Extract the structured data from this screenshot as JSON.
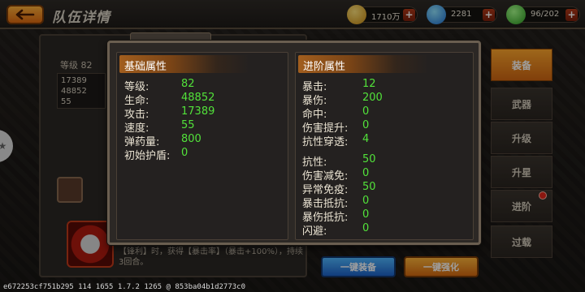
{
  "header": {
    "title": "队伍详情",
    "resources": [
      {
        "icon": "gold-coin-icon",
        "value": "1710万"
      },
      {
        "icon": "blue-gem-icon",
        "value": "2281"
      },
      {
        "icon": "green-stamina-icon",
        "value": "96/202"
      }
    ]
  },
  "background": {
    "rank_label": "等级 82",
    "mini_stats": [
      "17389",
      "48852",
      "55"
    ],
    "description": "【锋利】时，获得【暴击率】（暴击+100%），持续3回合。"
  },
  "side_tabs": [
    {
      "label": "装备",
      "active": true
    },
    {
      "label": "武器",
      "active": false
    },
    {
      "label": "升级",
      "active": false
    },
    {
      "label": "升星",
      "active": false
    },
    {
      "label": "进阶",
      "active": false
    },
    {
      "label": "过载",
      "active": false
    }
  ],
  "buttons": {
    "equip_all": "一键装备",
    "upgrade_all": "一键强化"
  },
  "modal": {
    "basic": {
      "title": "基础属性",
      "stats": [
        {
          "label": "等级:",
          "value": "82"
        },
        {
          "label": "生命:",
          "value": "48852"
        },
        {
          "label": "攻击:",
          "value": "17389"
        },
        {
          "label": "速度:",
          "value": "55"
        },
        {
          "label": "弹药量:",
          "value": "800"
        },
        {
          "label": "初始护盾:",
          "value": "0"
        }
      ]
    },
    "advanced": {
      "title": "进阶属性",
      "stats": [
        {
          "label": "暴击:",
          "value": "12"
        },
        {
          "label": "暴伤:",
          "value": "200"
        },
        {
          "label": "命中:",
          "value": "0"
        },
        {
          "label": "伤害提升:",
          "value": "0"
        },
        {
          "label": "抗性穿透:",
          "value": "4"
        },
        {
          "label": "抗性:",
          "value": "50"
        },
        {
          "label": "伤害减免:",
          "value": "0"
        },
        {
          "label": "异常免疫:",
          "value": "50"
        },
        {
          "label": "暴击抵抗:",
          "value": "0"
        },
        {
          "label": "暴伤抵抗:",
          "value": "0"
        },
        {
          "label": "闪避:",
          "value": "0"
        }
      ]
    }
  },
  "debug_string": "e672253cf751b295 114 1655 1.7.2 1265 @ 853ba04b1d2773c0",
  "colors": {
    "stat_value": "#52e23a",
    "accent_orange": "#ffa62c",
    "header_bar": "#a25e1e"
  }
}
